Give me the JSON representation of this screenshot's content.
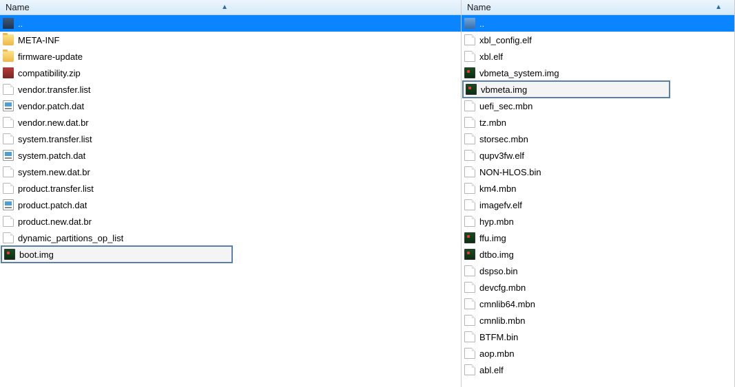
{
  "leftPane": {
    "header": "Name",
    "rows": [
      {
        "name": "..",
        "icon": "updir-dark",
        "selected": true,
        "boxed": false
      },
      {
        "name": "META-INF",
        "icon": "folder-yellow",
        "selected": false,
        "boxed": false
      },
      {
        "name": "firmware-update",
        "icon": "folder-yellow",
        "selected": false,
        "boxed": false
      },
      {
        "name": "compatibility.zip",
        "icon": "zip",
        "selected": false,
        "boxed": false
      },
      {
        "name": "vendor.transfer.list",
        "icon": "file-blank",
        "selected": false,
        "boxed": false
      },
      {
        "name": "vendor.patch.dat",
        "icon": "file-dat",
        "selected": false,
        "boxed": false
      },
      {
        "name": "vendor.new.dat.br",
        "icon": "file-blank",
        "selected": false,
        "boxed": false
      },
      {
        "name": "system.transfer.list",
        "icon": "file-blank",
        "selected": false,
        "boxed": false
      },
      {
        "name": "system.patch.dat",
        "icon": "file-dat",
        "selected": false,
        "boxed": false
      },
      {
        "name": "system.new.dat.br",
        "icon": "file-blank",
        "selected": false,
        "boxed": false
      },
      {
        "name": "product.transfer.list",
        "icon": "file-blank",
        "selected": false,
        "boxed": false
      },
      {
        "name": "product.patch.dat",
        "icon": "file-dat",
        "selected": false,
        "boxed": false
      },
      {
        "name": "product.new.dat.br",
        "icon": "file-blank",
        "selected": false,
        "boxed": false
      },
      {
        "name": "dynamic_partitions_op_list",
        "icon": "file-blank",
        "selected": false,
        "boxed": false
      },
      {
        "name": "boot.img",
        "icon": "img-file",
        "selected": false,
        "boxed": true
      }
    ]
  },
  "rightPane": {
    "header": "Name",
    "rows": [
      {
        "name": "..",
        "icon": "updir-light",
        "selected": true,
        "boxed": false
      },
      {
        "name": "xbl_config.elf",
        "icon": "file-blank",
        "selected": false,
        "boxed": false
      },
      {
        "name": "xbl.elf",
        "icon": "file-blank",
        "selected": false,
        "boxed": false
      },
      {
        "name": "vbmeta_system.img",
        "icon": "img-file",
        "selected": false,
        "boxed": false
      },
      {
        "name": "vbmeta.img",
        "icon": "img-file",
        "selected": false,
        "boxed": true
      },
      {
        "name": "uefi_sec.mbn",
        "icon": "file-blank",
        "selected": false,
        "boxed": false
      },
      {
        "name": "tz.mbn",
        "icon": "file-blank",
        "selected": false,
        "boxed": false
      },
      {
        "name": "storsec.mbn",
        "icon": "file-blank",
        "selected": false,
        "boxed": false
      },
      {
        "name": "qupv3fw.elf",
        "icon": "file-blank",
        "selected": false,
        "boxed": false
      },
      {
        "name": "NON-HLOS.bin",
        "icon": "file-blank",
        "selected": false,
        "boxed": false
      },
      {
        "name": "km4.mbn",
        "icon": "file-blank",
        "selected": false,
        "boxed": false
      },
      {
        "name": "imagefv.elf",
        "icon": "file-blank",
        "selected": false,
        "boxed": false
      },
      {
        "name": "hyp.mbn",
        "icon": "file-blank",
        "selected": false,
        "boxed": false
      },
      {
        "name": "ffu.img",
        "icon": "img-file",
        "selected": false,
        "boxed": false
      },
      {
        "name": "dtbo.img",
        "icon": "img-file",
        "selected": false,
        "boxed": false
      },
      {
        "name": "dspso.bin",
        "icon": "file-blank",
        "selected": false,
        "boxed": false
      },
      {
        "name": "devcfg.mbn",
        "icon": "file-blank",
        "selected": false,
        "boxed": false
      },
      {
        "name": "cmnlib64.mbn",
        "icon": "file-blank",
        "selected": false,
        "boxed": false
      },
      {
        "name": "cmnlib.mbn",
        "icon": "file-blank",
        "selected": false,
        "boxed": false
      },
      {
        "name": "BTFM.bin",
        "icon": "file-blank",
        "selected": false,
        "boxed": false
      },
      {
        "name": "aop.mbn",
        "icon": "file-blank",
        "selected": false,
        "boxed": false
      },
      {
        "name": "abl.elf",
        "icon": "file-blank",
        "selected": false,
        "boxed": false
      }
    ]
  }
}
